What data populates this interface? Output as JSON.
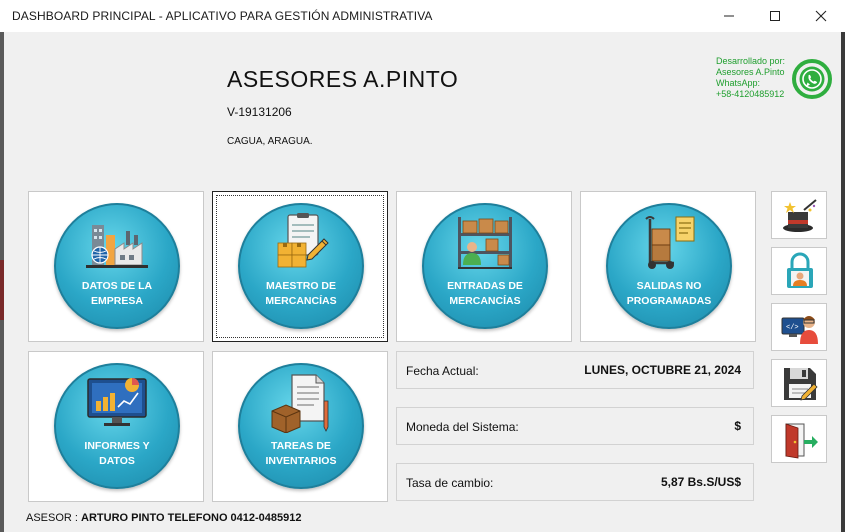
{
  "window": {
    "title": "DASHBOARD PRINCIPAL - APLICATIVO PARA GESTIÓN ADMINISTRATIVA"
  },
  "company": {
    "name": "ASESORES A.PINTO",
    "rif": "V-19131206",
    "city": "CAGUA, ARAGUA."
  },
  "developer": {
    "line1": "Desarrollado por:",
    "line2": "Asesores A.Pinto",
    "line3": "WhatsApp:",
    "line4": "+58-4120485912",
    "color": "#1f9e2e"
  },
  "modules": [
    {
      "line1": "DATOS DE LA",
      "line2": "EMPRESA",
      "icon": "factory-icon"
    },
    {
      "line1": "MAESTRO DE",
      "line2": "MERCANCÍAS",
      "icon": "clipboard-boxes-icon"
    },
    {
      "line1": "ENTRADAS DE",
      "line2": "MERCANCÍAS",
      "icon": "warehouse-shelf-icon"
    },
    {
      "line1": "SALIDAS NO",
      "line2": "PROGRAMADAS",
      "icon": "hand-truck-icon"
    },
    {
      "line1": "INFORMES Y",
      "line2": "DATOS",
      "icon": "monitor-chart-icon"
    },
    {
      "line1": "TAREAS DE",
      "line2": "INVENTARIOS",
      "icon": "document-box-icon"
    }
  ],
  "info": {
    "date_label": "Fecha Actual:",
    "date_value": "LUNES, OCTUBRE 21, 2024",
    "currency_label": "Moneda del Sistema:",
    "currency_value": "$",
    "rate_label": "Tasa de cambio:",
    "rate_value": "5,87 Bs.S/US$"
  },
  "side_buttons": [
    "magic-hat-icon",
    "lock-user-icon",
    "programmer-icon",
    "save-disk-icon",
    "exit-door-icon"
  ],
  "footer": {
    "label": "ASESOR :",
    "value": "ARTURO PINTO TELEFONO 0412-0485912"
  },
  "colors": {
    "tile_circle": "#2ba7c7",
    "panel_bg": "#f0f0f0"
  }
}
